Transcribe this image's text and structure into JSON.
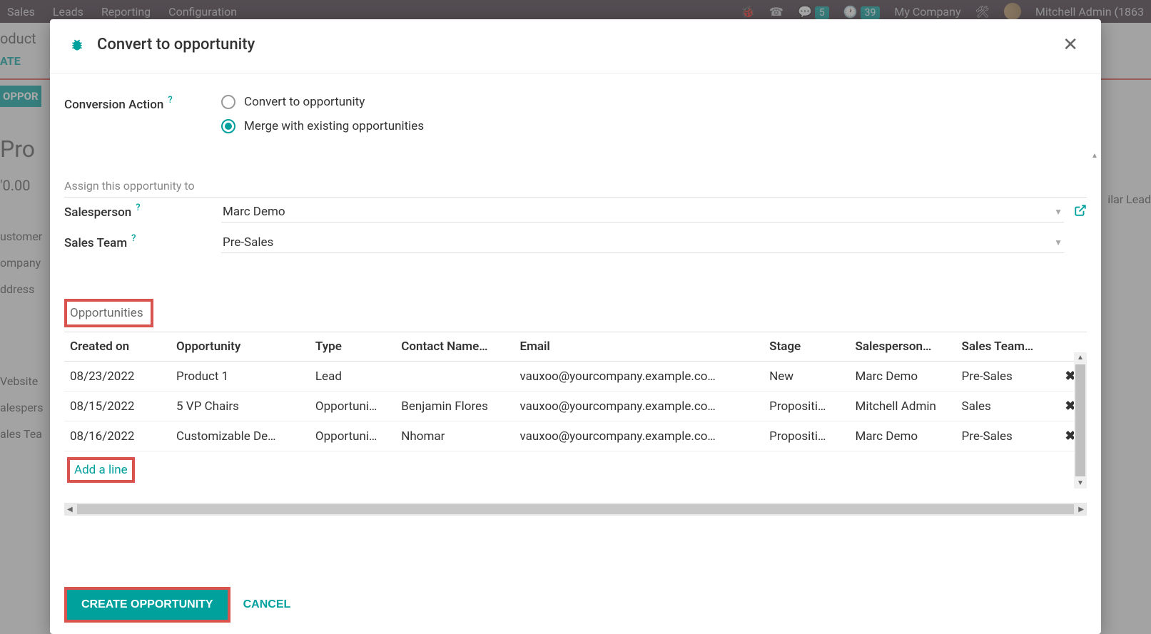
{
  "bg": {
    "menu": [
      "Sales",
      "Leads",
      "Reporting",
      "Configuration"
    ],
    "badge1": "5",
    "badge2": "39",
    "company": "My Company",
    "user": "Mitchell Admin (1863",
    "create": "ATE",
    "oppor_btn": "OPPOR",
    "product_big": "Pro",
    "product_mid": "oduct",
    "amount": "'0.00",
    "customer": "ustomer",
    "company_label": "ompany",
    "address": "ddress",
    "website": "Vebsite",
    "salespers": "alespers",
    "salesteam": "ales Tea",
    "similar": "ilar Lead"
  },
  "modal": {
    "title": "Convert to opportunity",
    "conversion_label": "Conversion Action",
    "option_convert": "Convert to opportunity",
    "option_merge": "Merge with existing opportunities",
    "assign_title": "Assign this opportunity to",
    "salesperson_label": "Salesperson",
    "salesperson_value": "Marc Demo",
    "salesteam_label": "Sales Team",
    "salesteam_value": "Pre-Sales",
    "opportunities_label": "Opportunities",
    "add_line": "Add a line",
    "create_btn": "CREATE OPPORTUNITY",
    "cancel_btn": "CANCEL"
  },
  "table": {
    "headers": {
      "created": "Created on",
      "opportunity": "Opportunity",
      "type": "Type",
      "contact": "Contact Name…",
      "email": "Email",
      "stage": "Stage",
      "salesperson": "Salesperson…",
      "team": "Sales Team…"
    },
    "rows": [
      {
        "created": "08/23/2022",
        "opp": "Product 1",
        "type": "Lead",
        "contact": "",
        "email": "vauxoo@yourcompany.example.co…",
        "stage": "New",
        "sp": "Marc Demo",
        "team": "Pre-Sales"
      },
      {
        "created": "08/15/2022",
        "opp": "5 VP Chairs",
        "type": "Opportuni…",
        "contact": "Benjamin Flores",
        "email": "vauxoo@yourcompany.example.co…",
        "stage": "Propositi…",
        "sp": "Mitchell Admin",
        "team": "Sales"
      },
      {
        "created": "08/16/2022",
        "opp": "Customizable De…",
        "type": "Opportuni…",
        "contact": "Nhomar",
        "email": "vauxoo@yourcompany.example.co…",
        "stage": "Propositi…",
        "sp": "Marc Demo",
        "team": "Pre-Sales"
      }
    ]
  }
}
